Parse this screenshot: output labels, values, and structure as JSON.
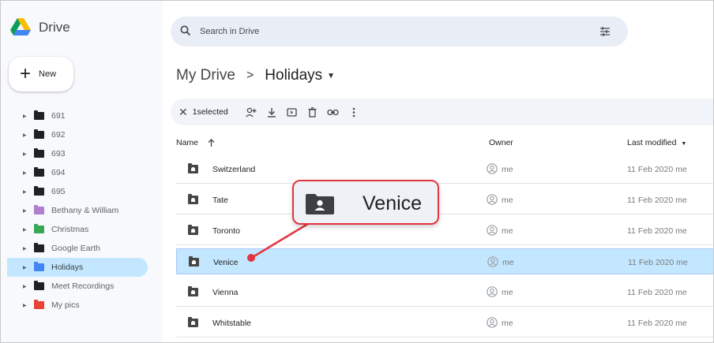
{
  "app": {
    "name": "Drive",
    "brand_colors": [
      "#0f9d58",
      "#fbbc04",
      "#4285f4"
    ]
  },
  "new_button": {
    "label": "New"
  },
  "search": {
    "placeholder": "Search in Drive"
  },
  "sidebar": {
    "items": [
      {
        "label": "691",
        "color": "#202124",
        "active": false
      },
      {
        "label": "692",
        "color": "#202124",
        "active": false
      },
      {
        "label": "693",
        "color": "#202124",
        "active": false
      },
      {
        "label": "694",
        "color": "#202124",
        "active": false
      },
      {
        "label": "695",
        "color": "#202124",
        "active": false
      },
      {
        "label": "Bethany & William",
        "color": "#b27fd0",
        "active": false
      },
      {
        "label": "Christmas",
        "color": "#3aa757",
        "active": false
      },
      {
        "label": "Google Earth",
        "color": "#202124",
        "active": false
      },
      {
        "label": "Holidays",
        "color": "#4285f4",
        "active": true
      },
      {
        "label": "Meet Recordings",
        "color": "#202124",
        "active": false
      },
      {
        "label": "My pics",
        "color": "#e94235",
        "active": false
      }
    ]
  },
  "breadcrumb": {
    "root": "My Drive",
    "separator": ">",
    "current": "Holidays"
  },
  "selection_bar": {
    "count_label": "1selected"
  },
  "columns": {
    "name": "Name",
    "owner": "Owner",
    "modified": "Last modified"
  },
  "files": [
    {
      "name": "Switzerland",
      "owner": "me",
      "modified": "11 Feb 2020 me",
      "selected": false
    },
    {
      "name": "Tate",
      "owner": "me",
      "modified": "11 Feb 2020 me",
      "selected": false
    },
    {
      "name": "Toronto",
      "owner": "me",
      "modified": "11 Feb 2020 me",
      "selected": false
    },
    {
      "name": "Venice",
      "owner": "me",
      "modified": "11 Feb 2020 me",
      "selected": true
    },
    {
      "name": "Vienna",
      "owner": "me",
      "modified": "11 Feb 2020 me",
      "selected": false
    },
    {
      "name": "Whitstable",
      "owner": "me",
      "modified": "11 Feb 2020 me",
      "selected": false
    }
  ],
  "callout": {
    "label": "Venice",
    "border_color": "#e2353f"
  }
}
